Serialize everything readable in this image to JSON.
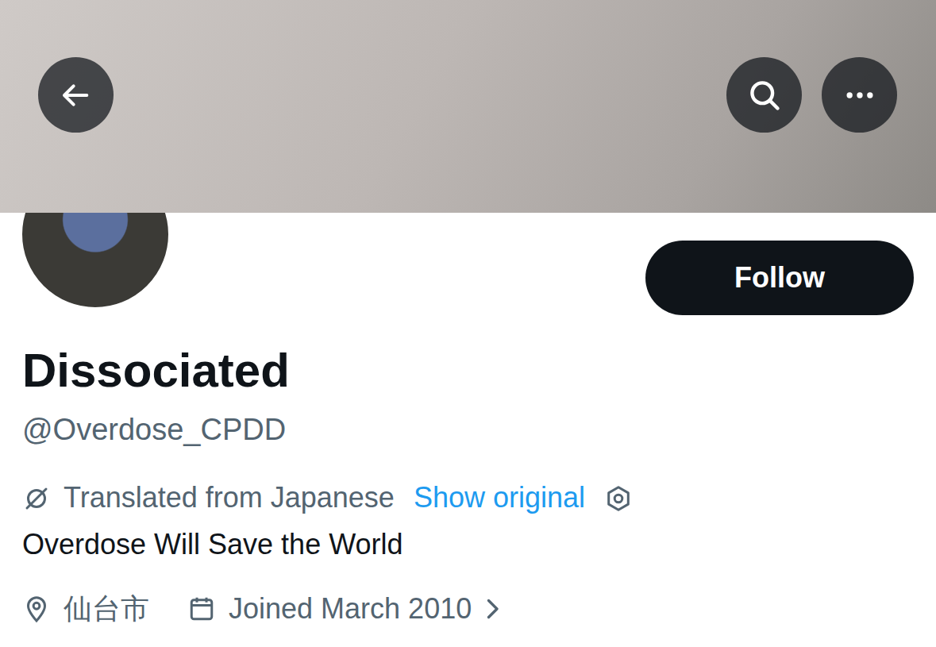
{
  "profile": {
    "name": "Dissociated",
    "handle": "@Overdose_CPDD",
    "bio": "Overdose Will Save the World",
    "location": "仙台市",
    "joined": "Joined March 2010"
  },
  "follow_button": {
    "label": "Follow"
  },
  "translation": {
    "label": "Translated from Japanese",
    "action": "Show original"
  }
}
